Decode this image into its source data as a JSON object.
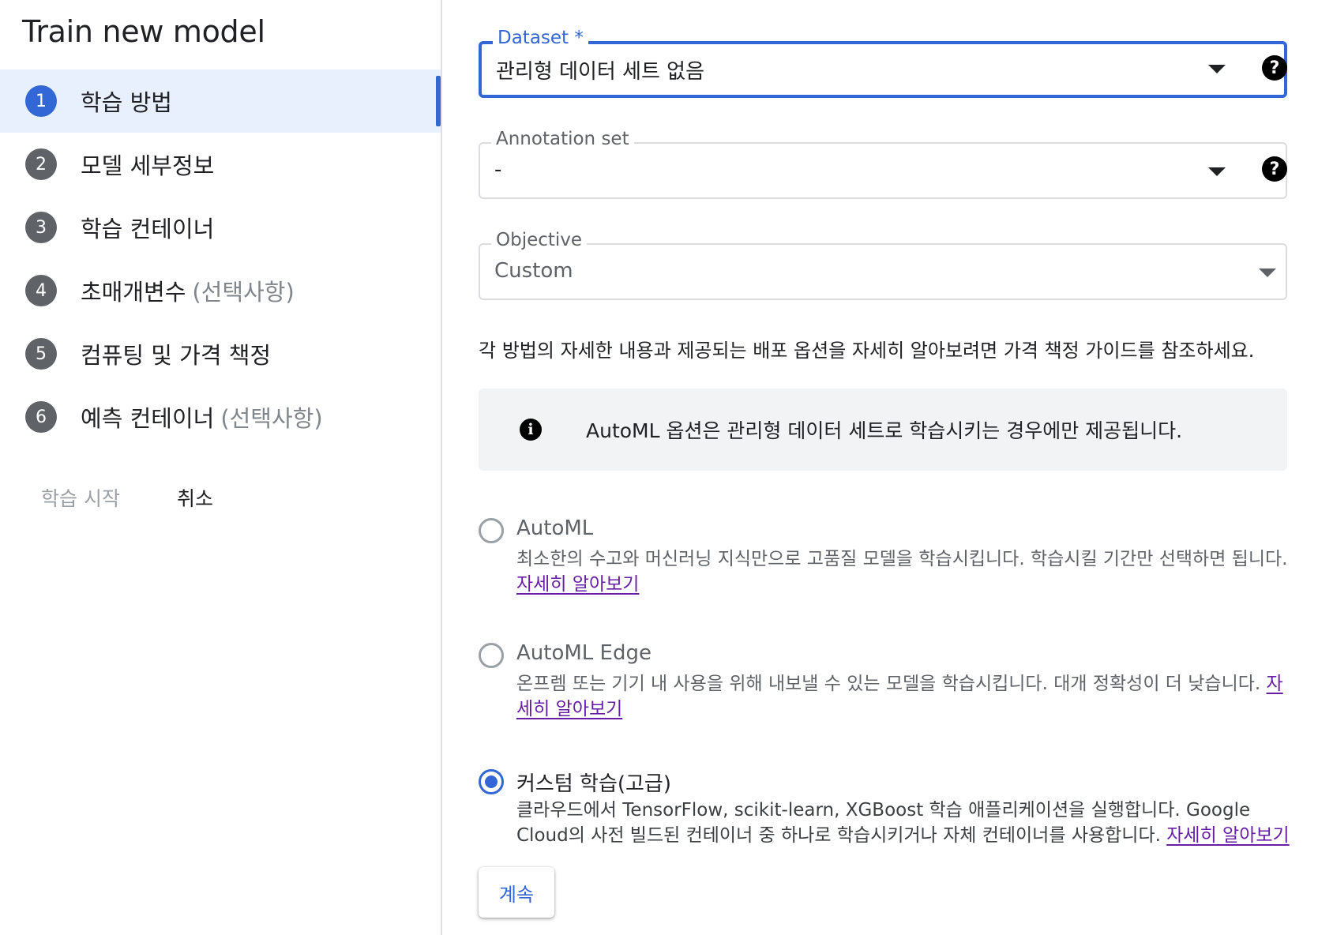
{
  "sidebar": {
    "title": "Train new model",
    "steps": [
      {
        "num": "1",
        "label": "학습 방법",
        "optional": ""
      },
      {
        "num": "2",
        "label": "모델 세부정보",
        "optional": ""
      },
      {
        "num": "3",
        "label": "학습 컨테이너",
        "optional": ""
      },
      {
        "num": "4",
        "label": "초매개변수",
        "optional": "(선택사항)"
      },
      {
        "num": "5",
        "label": "컴퓨팅 및 가격 책정",
        "optional": ""
      },
      {
        "num": "6",
        "label": "예측 컨테이너",
        "optional": "(선택사항)"
      }
    ],
    "start_label": "학습 시작",
    "cancel_label": "취소"
  },
  "form": {
    "dataset": {
      "label": "Dataset *",
      "value": "관리형 데이터 세트 없음"
    },
    "annotation_set": {
      "label": "Annotation set",
      "value": "-"
    },
    "objective": {
      "label": "Objective",
      "value": "Custom"
    },
    "description": "각 방법의 자세한 내용과 제공되는 배포 옵션을 자세히 알아보려면 가격 책정 가이드를 참조하세요.",
    "info_message": "AutoML 옵션은 관리형 데이터 세트로 학습시키는 경우에만 제공됩니다.",
    "options": [
      {
        "title": "AutoML",
        "desc": "최소한의 수고와 머신러닝 지식만으로 고품질 모델을 학습시킵니다. 학습시킬 기간만 선택하면 됩니다.",
        "link": "자세히 알아보기",
        "checked": false
      },
      {
        "title": "AutoML Edge",
        "desc": "온프렘 또는 기기 내 사용을 위해 내보낼 수 있는 모델을 학습시킵니다. 대개 정확성이 더 낮습니다.",
        "link": "자세히 알아보기",
        "checked": false
      },
      {
        "title": "커스텀 학습(고급)",
        "desc": "클라우드에서 TensorFlow, scikit-learn, XGBoost 학습 애플리케이션을 실행합니다. Google Cloud의 사전 빌드된 컨테이너 중 하나로 학습시키거나 자체 컨테이너를 사용합니다.",
        "link": "자세히 알아보기",
        "checked": true
      }
    ],
    "continue_label": "계속"
  },
  "icons": {
    "help": "help-circle-icon",
    "info": "info-icon",
    "dropdown": "dropdown-arrow-icon"
  },
  "colors": {
    "accent": "#3367d6",
    "link": "#681da8",
    "info_bg": "#f1f3f4"
  }
}
